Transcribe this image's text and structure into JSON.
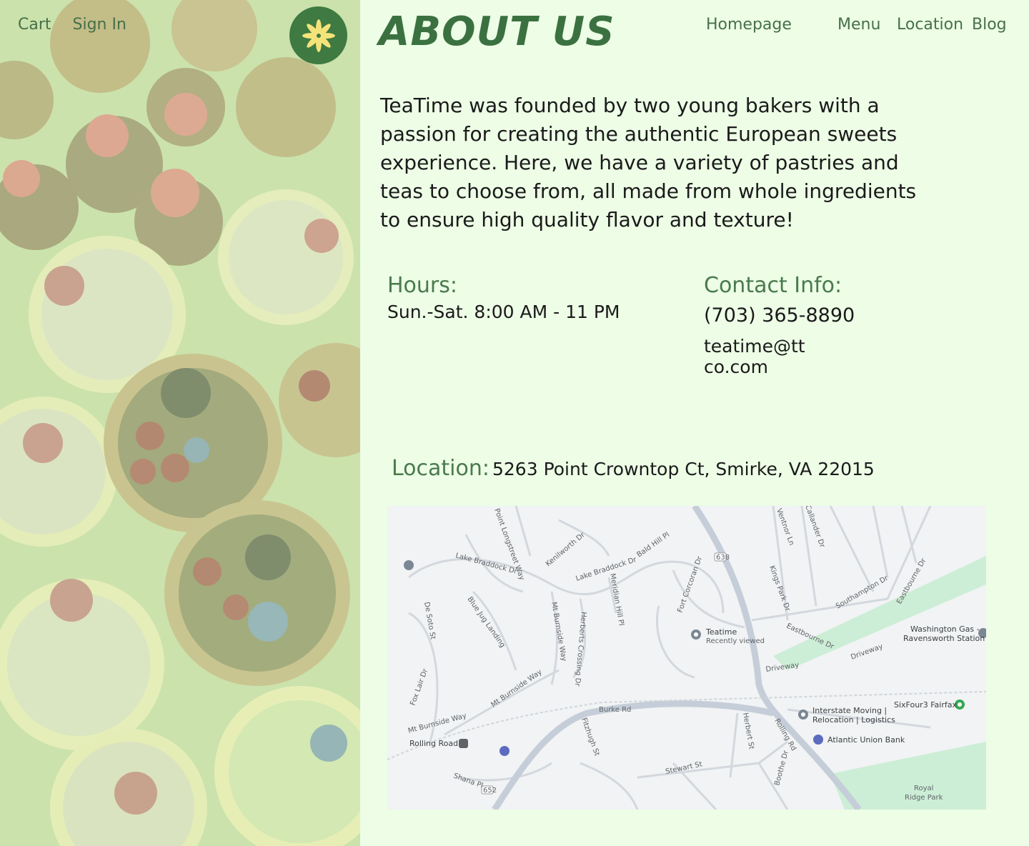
{
  "nav_left": {
    "cart": "Cart",
    "sign_in": "Sign In"
  },
  "nav_right": {
    "homepage": "Homepage",
    "menu": "Menu",
    "location": "Location",
    "blog": "Blog"
  },
  "page_title": "ABOUT US",
  "intro": "TeaTime was founded by two young bakers with a passion for creating the authentic European sweets experience. Here, we have a variety of pastries and teas to choose from, all made from whole ingredients to ensure high quality flavor and texture!",
  "hours": {
    "label": "Hours:",
    "value": "Sun.-Sat. 8:00 AM - 11 PM"
  },
  "contact": {
    "label": "Contact Info:",
    "phone": "(703) 365-8890",
    "email": "teatime@ttco.com"
  },
  "location": {
    "label": "Location:",
    "address": "5263 Point Crowntop Ct, Smirke, VA 22015"
  },
  "map": {
    "streets": [
      "Lake Braddock Dr",
      "Lake Braddock Dr",
      "Point Longstreet Way",
      "Kenilworth Dr",
      "Bald Hill Pl",
      "Ventnor Ln",
      "Callander Dr",
      "Kings Park Dr",
      "Southampton Dr",
      "Eastbourne Dr",
      "Eastbourne Dr",
      "De Soto St",
      "Blue Jug Landing",
      "Mt Burnside Way",
      "Mt Burnside Way",
      "Mt Burnside Way",
      "Herberts Crossing Dr",
      "Meridian Hill Pl",
      "Fort Corcoran Dr",
      "Fox Lair Dr",
      "Burke Rd",
      "Fitzhugh St",
      "Herbert St",
      "Rolling Rd",
      "Boothe Dr",
      "Stewart St",
      "Shana Pl",
      "Driveway",
      "Driveway"
    ],
    "places": [
      {
        "name": "Teatime",
        "sub": "Recently viewed"
      },
      {
        "name": "Washington Gas -",
        "sub": "Ravensworth Station"
      },
      {
        "name": "SixFour3 Fairfax",
        "sub": ""
      },
      {
        "name": "Interstate Moving |",
        "sub": "Relocation | Logistics"
      },
      {
        "name": "Atlantic Union Bank",
        "sub": ""
      },
      {
        "name": "Rolling Road",
        "sub": ""
      },
      {
        "name": "Royal",
        "sub": "Ridge Park"
      }
    ],
    "route_shields": [
      "638",
      "652"
    ]
  },
  "colors": {
    "accent_green": "#3b7140",
    "background": "#edfde6",
    "logo_flower": "#f5e37a"
  }
}
